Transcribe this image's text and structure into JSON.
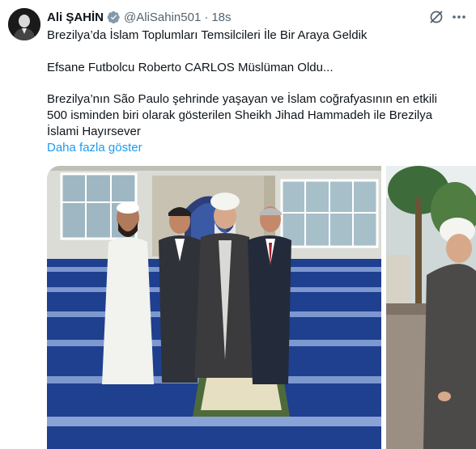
{
  "tweet": {
    "author_name": "Ali ŞAHİN",
    "author_handle": "@AliSahin501",
    "separator": "·",
    "timestamp": "18s",
    "lines": [
      "Brezilya’da İslam Toplumları Temsilcileri İle Bir Araya Geldik",
      "Efsane Futbolcu Roberto CARLOS Müslüman Oldu...",
      "Brezilya’nın São Paulo şehrinde yaşayan ve İslam coğrafyasının en etkili",
      "500 isminden biri olarak gösterilen Sheikh Jihad Hammadeh ile Brezilya",
      "İslami Hayırsever"
    ],
    "show_more": "Daha fazla göster"
  },
  "icons": {
    "verified": "verified-badge-icon",
    "grok": "grok-icon",
    "more": "more-options-icon"
  },
  "colors": {
    "text": "#0f1419",
    "secondary": "#536471",
    "link": "#1d9bf0",
    "verified": "#829aab"
  }
}
